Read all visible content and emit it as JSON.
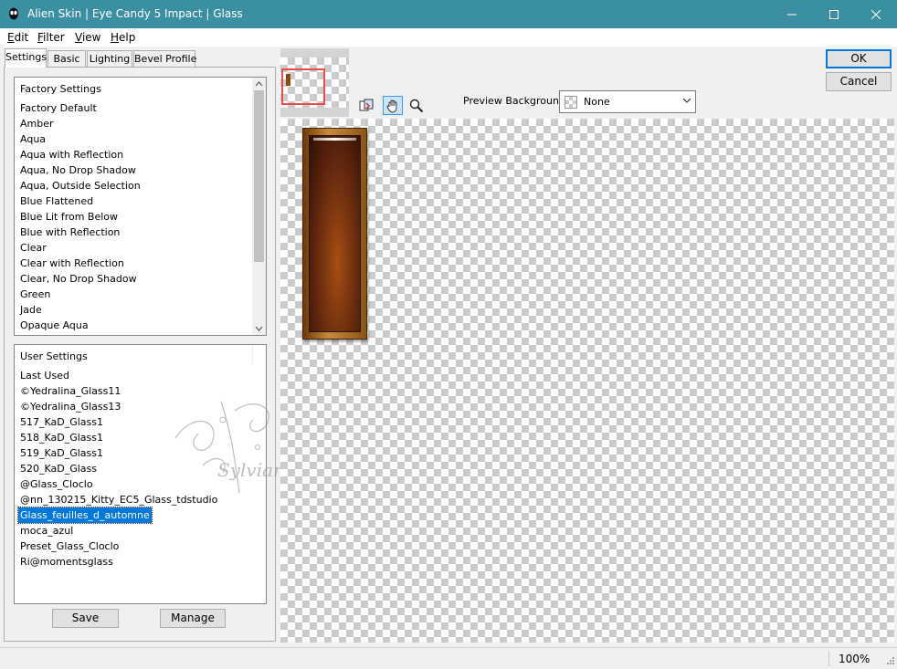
{
  "window": {
    "title": "Alien Skin | Eye Candy 5 Impact | Glass"
  },
  "menu": [
    {
      "label": "Edit",
      "key": "E"
    },
    {
      "label": "Filter",
      "key": "F"
    },
    {
      "label": "View",
      "key": "V"
    },
    {
      "label": "Help",
      "key": "H"
    }
  ],
  "tabs": [
    "Settings",
    "Basic",
    "Lighting",
    "Bevel Profile"
  ],
  "active_tab": "Settings",
  "factory": {
    "header": "Factory Settings",
    "items": [
      "Factory Default",
      "Amber",
      "Aqua",
      "Aqua with Reflection",
      "Aqua, No Drop Shadow",
      "Aqua, Outside Selection",
      "Blue Flattened",
      "Blue Lit from Below",
      "Blue with Reflection",
      "Clear",
      "Clear with Reflection",
      "Clear, No Drop Shadow",
      "Green",
      "Jade",
      "Opaque Aqua"
    ]
  },
  "user": {
    "header": "User Settings",
    "items": [
      "Last Used",
      "©Yedralina_Glass11",
      "©Yedralina_Glass13",
      "517_KaD_Glass1",
      "518_KaD_Glass1",
      "519_KaD_Glass1",
      "520_KaD_Glass",
      "@Glass_Cloclo",
      "@nn_130215_Kitty_EC5_Glass_tdstudio",
      "Glass_feuilles_d_automne",
      "moca_azul",
      "Preset_Glass_Cloclo",
      "Ri@momentsglass"
    ],
    "selected": "Glass_feuilles_d_automne"
  },
  "buttons": {
    "save": "Save",
    "manage": "Manage",
    "ok": "OK",
    "cancel": "Cancel"
  },
  "preview_background": {
    "label": "Preview Background:",
    "value": "None"
  },
  "tools": [
    "toggle-preview-icon",
    "hand-icon",
    "zoom-icon"
  ],
  "active_tool": "hand-icon",
  "status": {
    "zoom": "100%"
  },
  "watermark_text": "Sylviane",
  "colors": {
    "titlebar": "#3b8fa3",
    "selection": "#0078d7",
    "navigator_frame": "#e8504a"
  }
}
